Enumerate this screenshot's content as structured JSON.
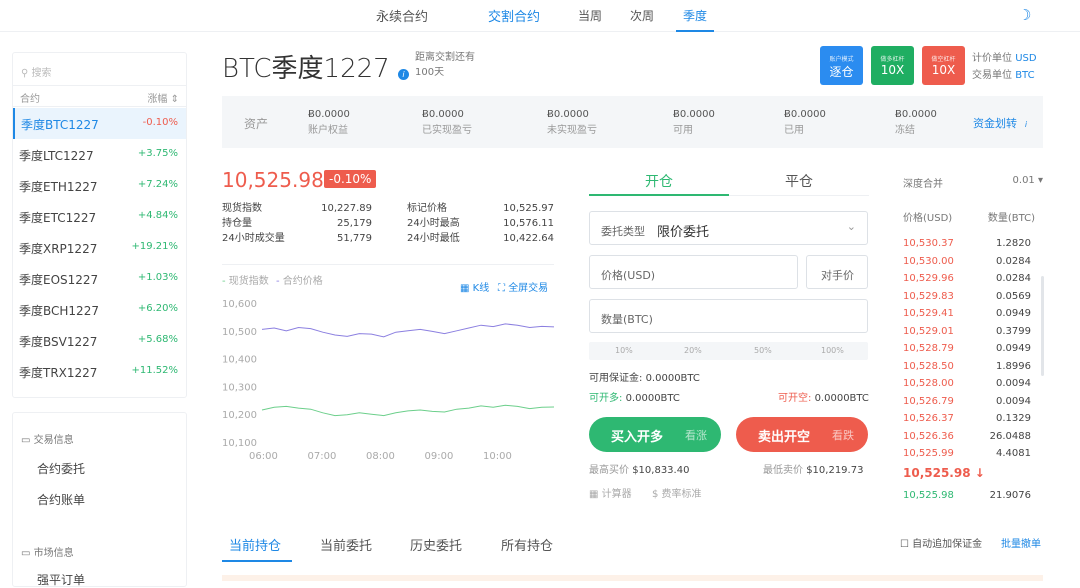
{
  "topnav": {
    "perpetual": "永续合约",
    "delivery": "交割合约",
    "this_week": "当周",
    "next_week": "次周",
    "quarter": "季度"
  },
  "sidebar": {
    "search_placeholder": "搜索",
    "col_contract": "合约",
    "col_change": "涨幅",
    "items": [
      {
        "name": "季度BTC1227",
        "change": "-0.10%"
      },
      {
        "name": "季度LTC1227",
        "change": "+3.75%"
      },
      {
        "name": "季度ETH1227",
        "change": "+7.24%"
      },
      {
        "name": "季度ETC1227",
        "change": "+4.84%"
      },
      {
        "name": "季度XRP1227",
        "change": "+19.21%"
      },
      {
        "name": "季度EOS1227",
        "change": "+1.03%"
      },
      {
        "name": "季度BCH1227",
        "change": "+6.20%"
      },
      {
        "name": "季度BSV1227",
        "change": "+5.68%"
      },
      {
        "name": "季度TRX1227",
        "change": "+11.52%"
      }
    ],
    "section_trade": "交易信息",
    "link_orders": "合约委托",
    "link_bill": "合约账单",
    "section_market": "市场信息",
    "link_liquidation": "强平订单"
  },
  "header": {
    "title": "BTC季度1227",
    "countdown_label": "距离交割还有",
    "countdown_value": "100天",
    "mode_small": "账户模式",
    "mode_big": "逐仓",
    "long_small": "做多杠杆",
    "long_big": "10X",
    "short_small": "做空杠杆",
    "short_big": "10X",
    "pricing_unit_label": "计价单位",
    "pricing_unit": "USD",
    "trade_unit_label": "交易单位",
    "trade_unit": "BTC"
  },
  "assets": {
    "label": "资产",
    "cells": [
      {
        "value": "Ƀ0.0000",
        "key": "账户权益"
      },
      {
        "value": "Ƀ0.0000",
        "key": "已实现盈亏"
      },
      {
        "value": "Ƀ0.0000",
        "key": "未实现盈亏"
      },
      {
        "value": "Ƀ0.0000",
        "key": "可用"
      },
      {
        "value": "Ƀ0.0000",
        "key": "已用"
      },
      {
        "value": "Ƀ0.0000",
        "key": "冻结"
      }
    ],
    "transfer": "资金划转"
  },
  "ticker": {
    "price": "10,525.98",
    "change": "-0.10%",
    "stats": [
      {
        "k": "现货指数",
        "v": "10,227.89"
      },
      {
        "k": "标记价格",
        "v": "10,525.97"
      },
      {
        "k": "持仓量",
        "v": "25,179"
      },
      {
        "k": "24小时最高",
        "v": "10,576.11"
      },
      {
        "k": "24小时成交量",
        "v": "51,779"
      },
      {
        "k": "24小时最低",
        "v": "10,422.64"
      }
    ]
  },
  "chart": {
    "legend_spot": "现货指数",
    "legend_contract": "合约价格",
    "kline": "K线",
    "fullscreen": "全屏交易"
  },
  "chart_data": {
    "type": "line",
    "x_ticks": [
      "06:00",
      "07:00",
      "08:00",
      "09:00",
      "10:00"
    ],
    "y_ticks": [
      "10,600",
      "10,500",
      "10,400",
      "10,300",
      "10,200",
      "10,100"
    ],
    "ylim": [
      10100,
      10600
    ],
    "series": [
      {
        "name": "合约价格",
        "color": "#8b7fe0",
        "values": [
          10505,
          10510,
          10500,
          10512,
          10508,
          10495,
          10485,
          10480,
          10490,
          10488,
          10478,
          10495,
          10500,
          10505,
          10498,
          10490,
          10500,
          10510,
          10520,
          10515,
          10525,
          10520,
          10512,
          10516,
          10514
        ]
      },
      {
        "name": "现货指数",
        "color": "#6ccf8b",
        "values": [
          10215,
          10225,
          10228,
          10222,
          10218,
          10205,
          10195,
          10198,
          10205,
          10200,
          10195,
          10205,
          10212,
          10215,
          10210,
          10208,
          10218,
          10222,
          10230,
          10225,
          10232,
          10228,
          10220,
          10225,
          10226
        ]
      }
    ]
  },
  "order": {
    "tab_open": "开仓",
    "tab_close": "平仓",
    "order_type_label": "委托类型",
    "order_type_value": "限价委托",
    "price_placeholder": "价格(USD)",
    "counter_price": "对手价",
    "qty_placeholder": "数量(BTC)",
    "pcts": [
      "10%",
      "20%",
      "50%",
      "100%"
    ],
    "margin_label": "可用保证金:",
    "margin_value": "0.0000BTC",
    "can_long_label": "可开多:",
    "can_long_value": "0.0000BTC",
    "can_short_label": "可开空:",
    "can_short_value": "0.0000BTC",
    "buy_main": "买入开多",
    "buy_sub": "看涨",
    "sell_main": "卖出开空",
    "sell_sub": "看跌",
    "best_buy_label": "最高买价",
    "best_buy": "$10,833.40",
    "best_sell_label": "最低卖价",
    "best_sell": "$10,219.73",
    "calculator": "计算器",
    "fees": "费率标准"
  },
  "orderbook": {
    "depth_label": "深度合并",
    "depth_value": "0.01",
    "col_price": "价格(USD)",
    "col_qty": "数量(BTC)",
    "asks": [
      {
        "p": "10,530.37",
        "q": "1.2820"
      },
      {
        "p": "10,530.00",
        "q": "0.0284"
      },
      {
        "p": "10,529.96",
        "q": "0.0284"
      },
      {
        "p": "10,529.83",
        "q": "0.0569"
      },
      {
        "p": "10,529.41",
        "q": "0.0949"
      },
      {
        "p": "10,529.01",
        "q": "0.3799"
      },
      {
        "p": "10,528.79",
        "q": "0.0949"
      },
      {
        "p": "10,528.50",
        "q": "1.8996"
      },
      {
        "p": "10,528.00",
        "q": "0.0094"
      },
      {
        "p": "10,526.79",
        "q": "0.0094"
      },
      {
        "p": "10,526.37",
        "q": "0.1329"
      },
      {
        "p": "10,526.36",
        "q": "26.0488"
      },
      {
        "p": "10,525.99",
        "q": "4.4081"
      }
    ],
    "last_price": "10,525.98",
    "bids": [
      {
        "p": "10,525.98",
        "q": "21.9076"
      }
    ]
  },
  "bottom": {
    "tabs": [
      "当前持仓",
      "当前委托",
      "历史委托",
      "所有持仓"
    ],
    "auto_margin": "自动追加保证金",
    "batch_cancel": "批量撤单"
  }
}
